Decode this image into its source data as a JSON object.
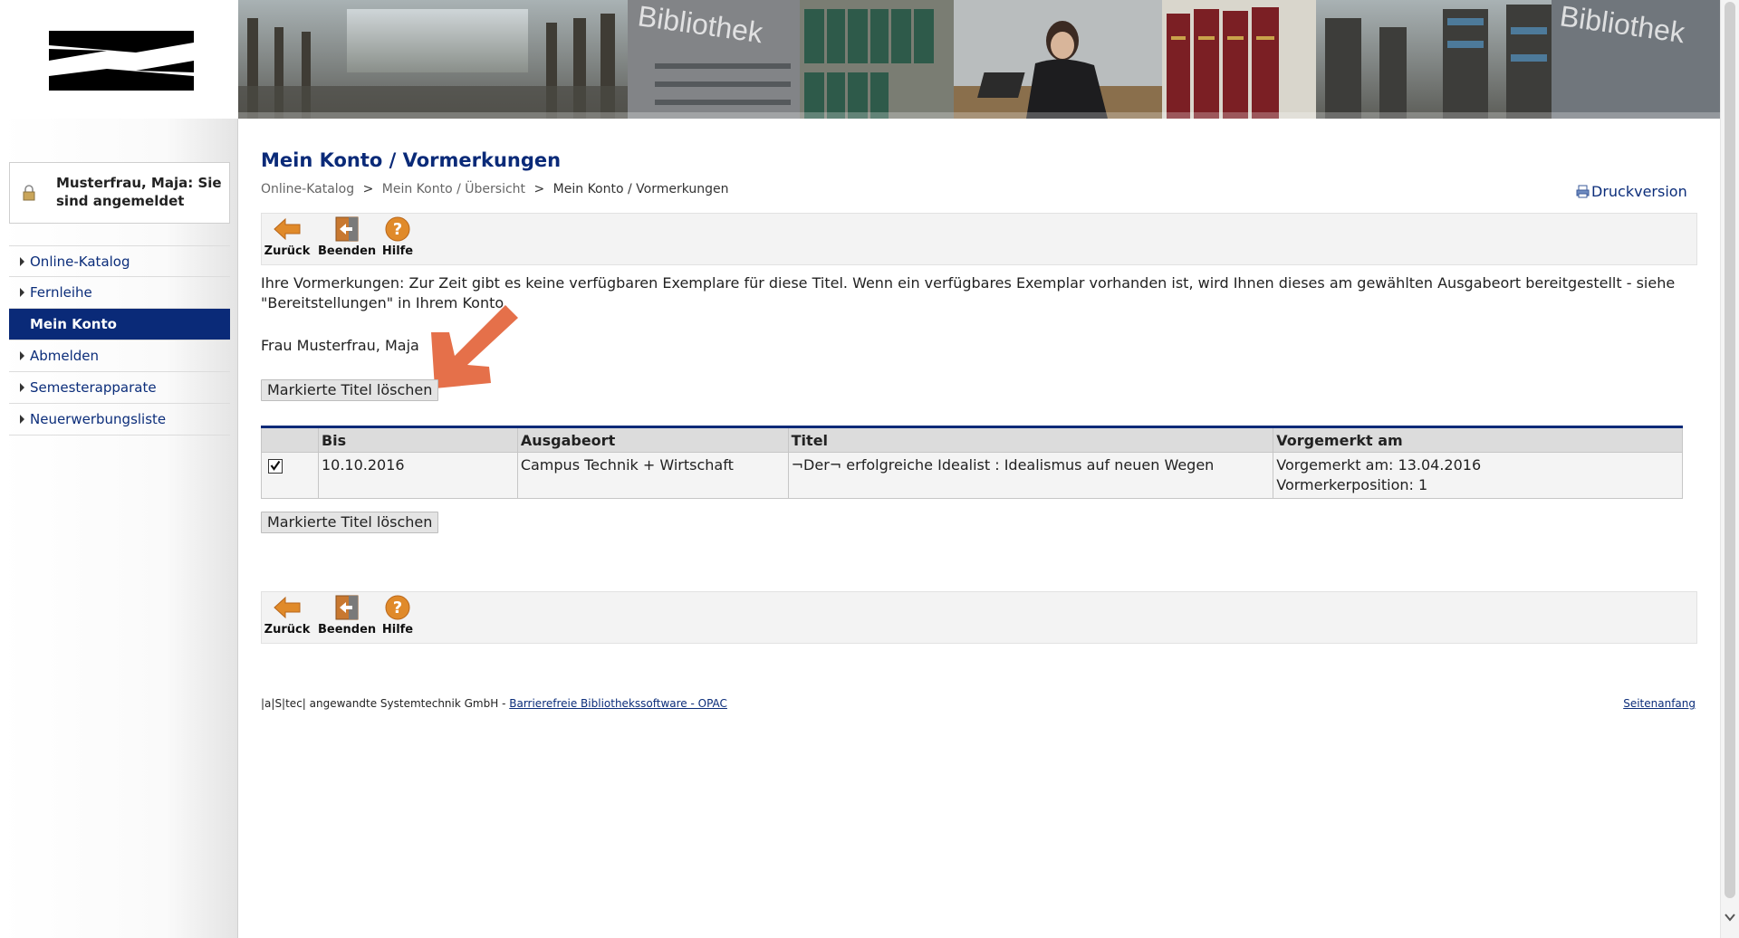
{
  "banner": {
    "sign_text_1": "Bibliothek",
    "sign_text_2": "Bibliothek"
  },
  "user": {
    "login_status": "Musterfrau, Maja: Sie sind angemeldet"
  },
  "sidebar": {
    "items": [
      {
        "label": "Online-Katalog",
        "active": false
      },
      {
        "label": "Fernleihe",
        "active": false
      },
      {
        "label": "Mein Konto",
        "active": true
      },
      {
        "label": "Abmelden",
        "active": false
      },
      {
        "label": "Semesterapparate",
        "active": false
      },
      {
        "label": "Neuerwerbungsliste",
        "active": false
      }
    ]
  },
  "page": {
    "title": "Mein Konto / Vormerkungen",
    "breadcrumb": {
      "items": [
        "Online-Katalog",
        "Mein Konto / Übersicht"
      ],
      "current": "Mein Konto / Vormerkungen",
      "separator": ">"
    },
    "print_link": "Druckversion"
  },
  "toolbar": {
    "back_label": "Zurück",
    "exit_label": "Beenden",
    "help_label": "Hilfe"
  },
  "content": {
    "info_text": "Ihre Vormerkungen: Zur Zeit gibt es keine verfügbaren Exemplare für diese Titel. Wenn ein verfügbares Exemplar vorhanden ist, wird Ihnen dieses am gewählten Ausgabeort bereitgestellt - siehe \"Bereitstellungen\" in Ihrem Konto.",
    "user_name": "Frau Musterfrau, Maja",
    "delete_button_label": "Markierte Titel löschen"
  },
  "table": {
    "headers": [
      "",
      "Bis",
      "Ausgabeort",
      "Titel",
      "Vorgemerkt am"
    ],
    "rows": [
      {
        "checked": true,
        "bis": "10.10.2016",
        "ausgabeort": "Campus Technik + Wirtschaft",
        "titel": "¬Der¬ erfolgreiche Idealist : Idealismus auf neuen Wegen",
        "vorgemerkt_am": "Vorgemerkt am: 13.04.2016",
        "position": "Vormerkerposition: 1"
      }
    ]
  },
  "footer": {
    "company": "|a|S|tec| angewandte Systemtechnik GmbH - ",
    "software_link": "Barrierefreie Bibliothekssoftware - OPAC",
    "top_link": "Seitenanfang"
  },
  "colors": {
    "brand_navy": "#0a2a78",
    "link_blue": "#0b2d7a",
    "annotation_arrow": "#e5704a",
    "toolbar_icon_orange": "#e08a2a"
  }
}
